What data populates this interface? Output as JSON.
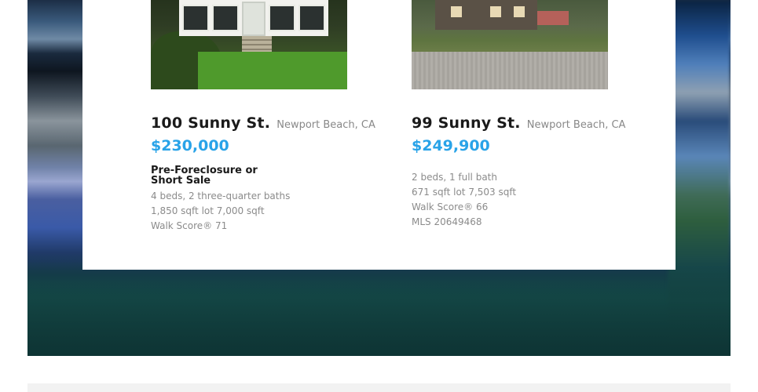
{
  "listings": [
    {
      "street": "100 Sunny St.",
      "city": "Newport Beach, CA",
      "price": "$230,000",
      "status": "Pre-Foreclosure or Short Sale",
      "details": [
        "4 beds,  2 three-quarter baths",
        "1,850 sqft   lot 7,000 sqft",
        "Walk Score® 71"
      ]
    },
    {
      "street": "99 Sunny St.",
      "city": "Newport Beach, CA",
      "price": "$249,900",
      "details": [
        "2 beds,  1 full bath",
        "671 sqft   lot 7,503 sqft",
        "Walk Score® 66",
        "MLS 20649468"
      ]
    }
  ],
  "colors": {
    "price": "#29a3e8",
    "title": "#1a1a1a",
    "muted": "#8b8b8b"
  }
}
